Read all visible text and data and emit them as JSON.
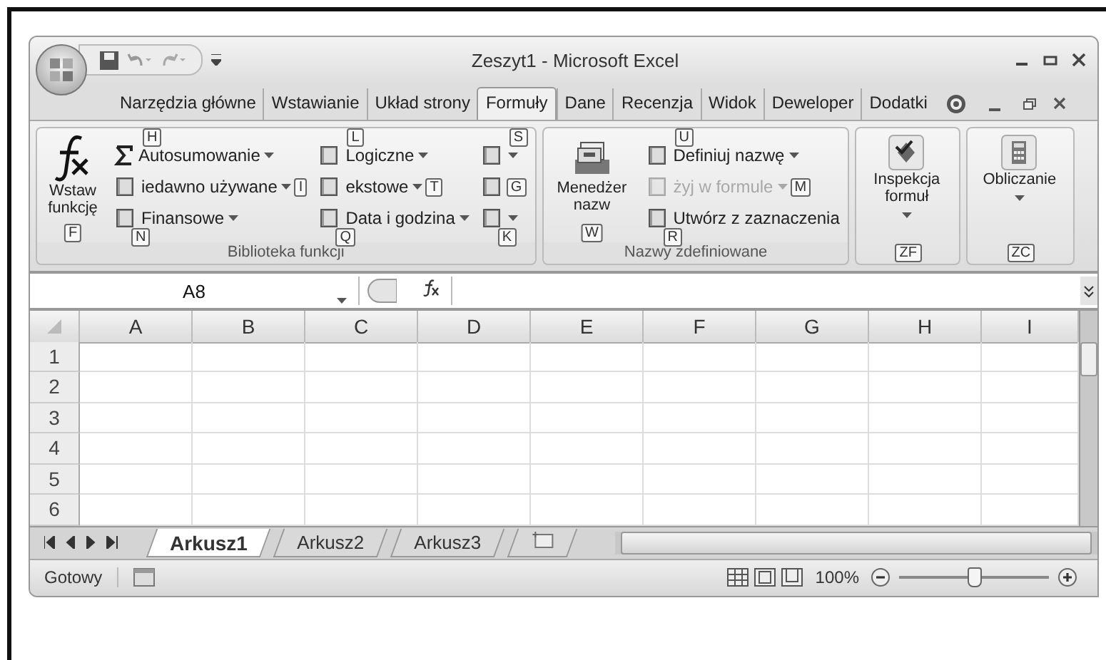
{
  "window": {
    "title": "Zeszyt1 - Microsoft Excel"
  },
  "ribbon_tabs": [
    {
      "label": "Narzędzia główne",
      "selected": false
    },
    {
      "label": "Wstawianie",
      "selected": false
    },
    {
      "label": "Układ strony",
      "selected": false
    },
    {
      "label": "Formuły",
      "selected": true
    },
    {
      "label": "Dane",
      "selected": false
    },
    {
      "label": "Recenzja",
      "selected": false
    },
    {
      "label": "Widok",
      "selected": false
    },
    {
      "label": "Deweloper",
      "selected": false
    },
    {
      "label": "Dodatki",
      "selected": false
    }
  ],
  "ribbon_groups": [
    {
      "label": "Biblioteka funkcji",
      "big_button": {
        "label": "Wstaw funkcję",
        "keytip": "F",
        "dropdown": false
      },
      "columns": [
        [
          {
            "label": "Autosumowanie",
            "keytip": "H",
            "dropdown": true,
            "disabled": false
          },
          {
            "label": "iedawno używane",
            "keytip": "I",
            "dropdown": true,
            "disabled": false
          },
          {
            "label": "Finansowe",
            "keytip": "N",
            "dropdown": true,
            "disabled": false
          }
        ],
        [
          {
            "label": "Logiczne",
            "keytip": "L",
            "dropdown": true,
            "disabled": false
          },
          {
            "label": "ekstowe",
            "keytip": "T",
            "dropdown": true,
            "disabled": false
          },
          {
            "label": "Data i godzina",
            "keytip": "Q",
            "dropdown": true,
            "disabled": false
          }
        ],
        [
          {
            "keytip": "S",
            "dropdown": true,
            "disabled": false
          },
          {
            "keytip": "G",
            "dropdown": false,
            "disabled": false
          },
          {
            "keytip": "K",
            "dropdown": true,
            "disabled": false
          }
        ]
      ]
    },
    {
      "label": "Nazwy zdefiniowane",
      "big_button": {
        "label": "Menedżer nazw",
        "keytip": "W",
        "dropdown": false
      },
      "columns": [
        [
          {
            "label": "Definiuj nazwę",
            "keytip": "U",
            "dropdown": true,
            "disabled": false
          },
          {
            "label": "żyj w formule",
            "keytip": "M",
            "dropdown": true,
            "disabled": true
          },
          {
            "label": "Utwórz z zaznaczenia",
            "keytip": "R",
            "dropdown": false,
            "disabled": false
          }
        ]
      ]
    },
    {
      "big_button": {
        "label": "Inspekcja formuł",
        "keytip": "ZF",
        "dropdown": true
      }
    },
    {
      "big_button": {
        "label": "Obliczanie",
        "keytip": "ZC",
        "dropdown": true
      }
    }
  ],
  "formula_bar": {
    "name_box": "A8"
  },
  "sheet": {
    "columns": [
      "A",
      "B",
      "C",
      "D",
      "E",
      "F",
      "G",
      "H",
      "I"
    ],
    "rows": [
      "1",
      "2",
      "3",
      "4",
      "5",
      "6"
    ]
  },
  "sheet_tabs": [
    {
      "label": "Arkusz1",
      "selected": true
    },
    {
      "label": "Arkusz2",
      "selected": false
    },
    {
      "label": "Arkusz3",
      "selected": false
    }
  ],
  "status_bar": {
    "status": "Gotowy",
    "zoom": "100%",
    "zoom_slider": {
      "level": 0.5
    }
  }
}
